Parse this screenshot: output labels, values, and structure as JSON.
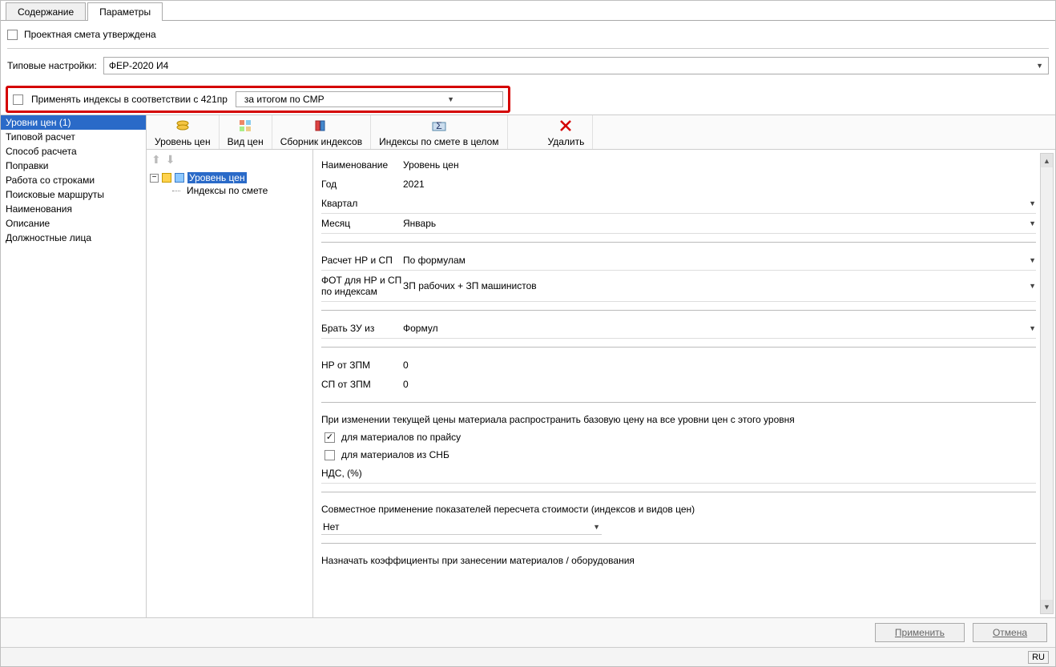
{
  "tabs": {
    "content": "Содержание",
    "params": "Параметры"
  },
  "approved_label": "Проектная смета утверждена",
  "typical": {
    "label": "Типовые настройки:",
    "value": "ФЕР-2020 И4"
  },
  "apply_index": {
    "label": "Применять индексы в соответствии с 421пр",
    "select_value": "за итогом по СМР"
  },
  "sidebar": {
    "items": [
      "Уровни цен (1)",
      "Типовой расчет",
      "Способ расчета",
      "Поправки",
      "Работа со строками",
      "Поисковые маршруты",
      "Наименования",
      "Описание",
      "Должностные лица"
    ]
  },
  "toolbar": {
    "level": "Уровень цен",
    "view": "Вид цен",
    "collection": "Сборник индексов",
    "estimate_idx": "Индексы по смете в целом",
    "delete": "Удалить"
  },
  "tree": {
    "root": "Уровень цен",
    "child": "Индексы по смете"
  },
  "form": {
    "name_label": "Наименование",
    "name_value": "Уровень цен",
    "year_label": "Год",
    "year_value": "2021",
    "quarter_label": "Квартал",
    "quarter_value": "",
    "month_label": "Месяц",
    "month_value": "Январь",
    "calc_label": "Расчет НР и СП",
    "calc_value": "По формулам",
    "fot_label": "ФОТ для НР и СП по индексам",
    "fot_value": "ЗП рабочих + ЗП машинистов",
    "zu_label": "Брать ЗУ из",
    "zu_value": "Формул",
    "nr_zpm_label": "НР от ЗПМ",
    "nr_zpm_value": "0",
    "sp_zpm_label": "СП от ЗПМ",
    "sp_zpm_value": "0",
    "propagate_label": "При изменении текущей цены материала распространить базовую цену на все уровни цен с этого уровня",
    "cb1": "для материалов по прайсу",
    "cb2": "для материалов из СНБ",
    "nds_label": "НДС, (%)",
    "nds_value": "",
    "joint_label": "Совместное применение показателей пересчета стоимости (индексов и видов цен)",
    "joint_value": "Нет",
    "assign_label": "Назначать коэффициенты при занесении материалов / оборудования"
  },
  "footer": {
    "apply": "Применить",
    "cancel": "Отмена"
  },
  "status": {
    "lang": "RU"
  }
}
